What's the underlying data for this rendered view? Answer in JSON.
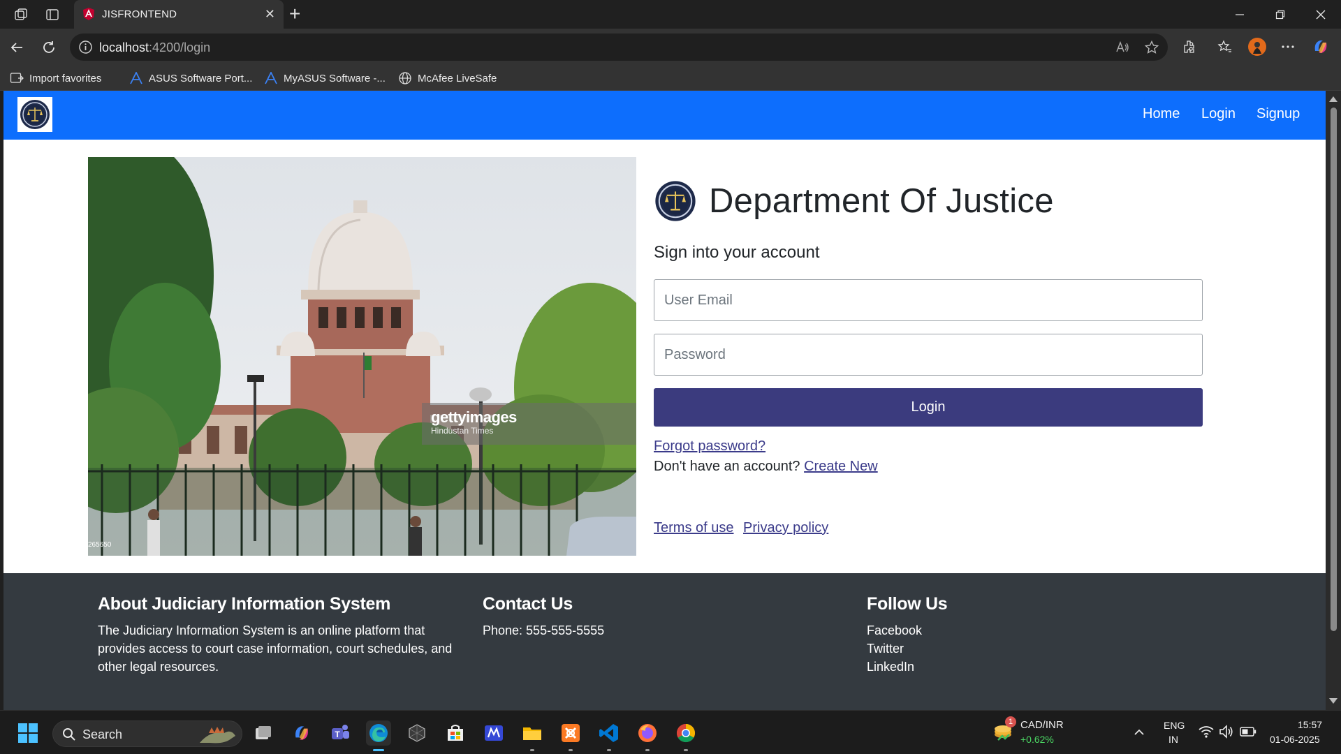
{
  "browser": {
    "tab_title": "JISFRONTEND",
    "tab_close": "✕",
    "new_tab": "+",
    "url_host": "localhost",
    "url_path": ":4200/login",
    "bookmarks": [
      {
        "label": "Import favorites"
      },
      {
        "label": "ASUS Software Port..."
      },
      {
        "label": "MyASUS Software -..."
      },
      {
        "label": "McAfee LiveSafe"
      }
    ]
  },
  "navbar": {
    "links": [
      "Home",
      "Login",
      "Signup"
    ]
  },
  "hero": {
    "watermark": "gettyimages",
    "credit": "Hindustan Times",
    "image_id": "265650"
  },
  "login": {
    "brand_title": "Department Of Justice",
    "heading": "Sign into your account",
    "email_placeholder": "User Email",
    "password_placeholder": "Password",
    "button": "Login",
    "forgot": "Forgot password?",
    "no_account": "Don't have an account?",
    "create": "Create New",
    "terms": "Terms of use",
    "privacy": "Privacy policy"
  },
  "footer": {
    "about": {
      "heading": "About Judiciary Information System",
      "text": "The Judiciary Information System is an online platform that provides access to court case information, court schedules, and other legal resources."
    },
    "contact": {
      "heading": "Contact Us",
      "phone": "Phone: 555-555-5555"
    },
    "follow": {
      "heading": "Follow Us",
      "links": [
        "Facebook",
        "Twitter",
        "LinkedIn"
      ]
    }
  },
  "taskbar": {
    "search": "Search",
    "currency": "CAD/INR",
    "change": "+0.62%",
    "notif_count": "1",
    "lang": "ENG",
    "region": "IN",
    "time": "15:57",
    "date": "01-06-2025"
  },
  "colors": {
    "navbar": "#0d6efd",
    "button": "#3b3b7e",
    "footer": "#343a40",
    "change_positive": "#4cd964"
  }
}
